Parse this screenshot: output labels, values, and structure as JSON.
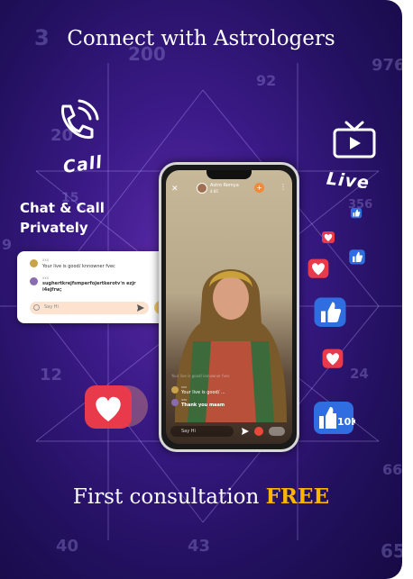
{
  "title": "Connect with Astrologers",
  "call_label": "Call",
  "live_label": "Live",
  "chat_label_line1": "Chat & Call",
  "chat_label_line2": "Privately",
  "chat_card": {
    "messages": [
      {
        "name": "xxx",
        "text": "Your live is good/ knnowner fvec"
      },
      {
        "name": "xxx",
        "text": "sughertkrejfsmperfojertkerotv'n ezjr i4ejfrw;"
      }
    ],
    "input_placeholder": "Say Hi"
  },
  "phone": {
    "host_name": "Astro Remya",
    "host_rating": "4.85",
    "comments": [
      {
        "name": "xxx",
        "text": "Your live is good/ knnowner fvec"
      },
      {
        "name": "xxx",
        "text": "Your live is good/ ..."
      },
      {
        "name": "xxx",
        "text": "Thank you maam"
      }
    ],
    "input_placeholder": "Say Hi"
  },
  "footer_prefix": "First consultation ",
  "footer_highlight": "FREE",
  "bg_numbers": [
    "3",
    "200",
    "976",
    "92",
    "20",
    "15",
    "9",
    "12",
    "24",
    "356",
    "66",
    "40",
    "43",
    "65"
  ],
  "colors": {
    "accent": "#ffb400",
    "bg": "#2a1470",
    "heart": "#e83a4a",
    "like": "#2f6de0"
  }
}
